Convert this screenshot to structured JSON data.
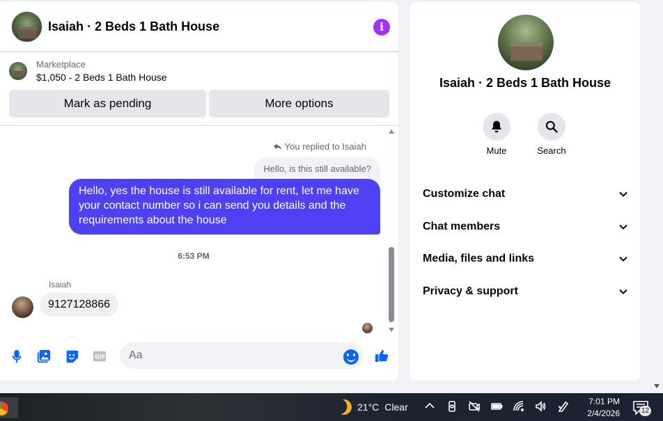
{
  "chat": {
    "title": "Isaiah · 2 Beds 1 Bath House",
    "listing": {
      "label": "Marketplace",
      "price_title": "$1,050 - 2 Beds 1 Bath House",
      "mark_pending_label": "Mark as pending",
      "more_options_label": "More options"
    },
    "messages": {
      "replied_label": "You replied to Isaiah",
      "quoted_text": "Hello, is this still available?",
      "outgoing_text": "Hello, yes the house is still available for rent, let me have your contact number so i can send you details and the requirements about the house",
      "timestamp": "6:53 PM",
      "incoming_sender": "Isaiah",
      "incoming_text": "9127128866"
    },
    "composer": {
      "placeholder": "Aa"
    }
  },
  "side": {
    "title": "Isaiah · 2 Beds 1 Bath House",
    "actions": [
      {
        "label": "Mute",
        "icon": "bell-icon"
      },
      {
        "label": "Search",
        "icon": "search-icon"
      }
    ],
    "menu": [
      {
        "label": "Customize chat"
      },
      {
        "label": "Chat members"
      },
      {
        "label": "Media, files and links"
      },
      {
        "label": "Privacy & support"
      }
    ]
  },
  "taskbar": {
    "temperature": "21°C",
    "weather": "Clear",
    "time": "7:01 PM",
    "date": "2/4/2026",
    "notification_count": "12"
  },
  "colors": {
    "accent": "#0866ff",
    "bubble_out": "#4e41f4",
    "info": "#a033ff"
  }
}
